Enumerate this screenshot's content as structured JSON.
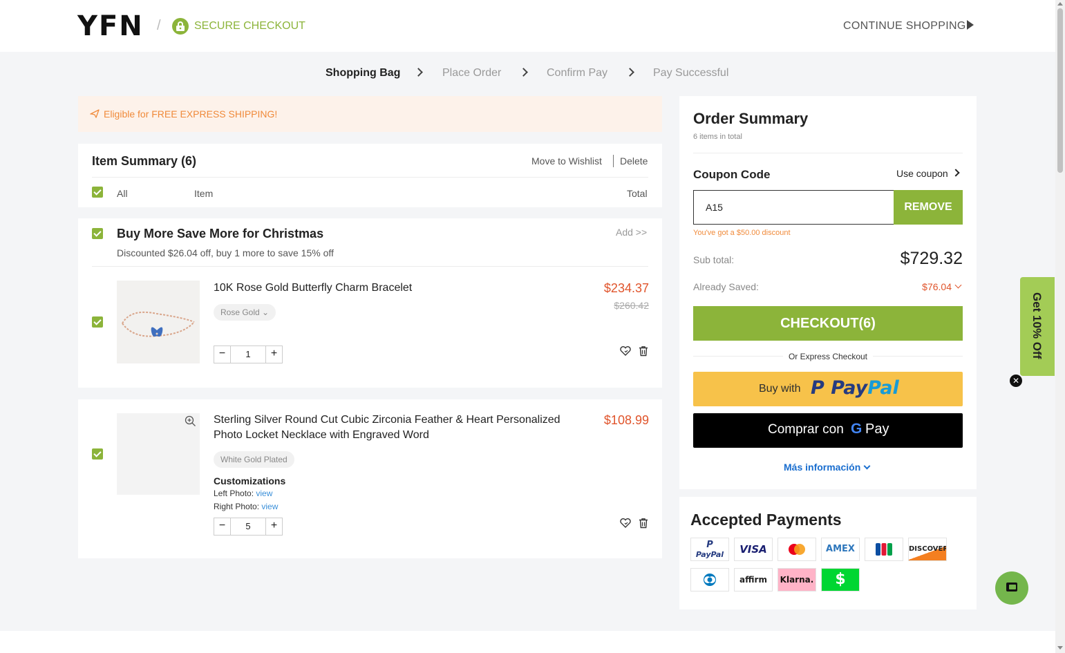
{
  "header": {
    "logo": "YFN",
    "separator": "/",
    "secure_label": "SECURE CHECKOUT",
    "continue_label": "CONTINUE SHOPPING"
  },
  "steps": [
    {
      "label": "Shopping Bag",
      "active": true
    },
    {
      "label": "Place Order",
      "active": false
    },
    {
      "label": "Confirm Pay",
      "active": false
    },
    {
      "label": "Pay Successful",
      "active": false
    }
  ],
  "banner": {
    "text": "Eligible for FREE EXPRESS SHIPPING!"
  },
  "item_summary": {
    "title": "Item Summary (6)",
    "move_to_wishlist": "Move to Wishlist",
    "delete": "Delete",
    "col_all": "All",
    "col_item": "Item",
    "col_total": "Total"
  },
  "promo_group": {
    "title": "Buy More Save More for Christmas",
    "subtitle": "Discounted $26.04 off, buy 1 more to save 15% off",
    "add_link": "Add >>"
  },
  "items": [
    {
      "name": "10K Rose Gold Butterfly Charm Bracelet",
      "variant": "Rose Gold",
      "price": "$234.37",
      "old_price": "$260.42",
      "quantity": "1"
    },
    {
      "name_line1": "Sterling Silver Round Cut Cubic Zirconia Feather & Heart Personalized",
      "name_line2": "Photo Locket Necklace with Engraved Word",
      "variant": "White Gold Plated",
      "price": "$108.99",
      "customizations_title": "Customizations",
      "left_photo_label": "Left Photo:",
      "right_photo_label": "Right Photo:",
      "view_link": "view",
      "quantity": "5"
    }
  ],
  "summary": {
    "title": "Order Summary",
    "count": "6 items in total",
    "coupon_label": "Coupon Code",
    "use_coupon": "Use coupon",
    "coupon_value": "A15",
    "remove_label": "REMOVE",
    "coupon_message": "You've got a $50.00 discount",
    "subtotal_label": "Sub total:",
    "subtotal_value": "$729.32",
    "saved_label": "Already Saved:",
    "saved_value": "$76.04",
    "checkout_label": "CHECKOUT(6)",
    "express_label": "Or Express Checkout",
    "paypal_prefix": "Buy with",
    "paypal_brand": "PayPal",
    "gpay_prefix": "Comprar con",
    "gpay_g": "G",
    "gpay_pay": "Pay",
    "more_info": "Más información"
  },
  "payments": {
    "title": "Accepted Payments",
    "cards": [
      "PayPal",
      "VISA",
      "Mastercard",
      "AMEX",
      "JCB",
      "DISCOVER",
      "Diners Club",
      "affirm",
      "Klarna.",
      "$"
    ]
  },
  "promo_tab": {
    "label": "Get 10% Off",
    "close": "✕"
  },
  "colors": {
    "accent": "#8cb43a",
    "price": "#e0542b",
    "notice": "#f08a3a",
    "link": "#1a6ecf",
    "paypal_bg": "#f7c24a"
  }
}
